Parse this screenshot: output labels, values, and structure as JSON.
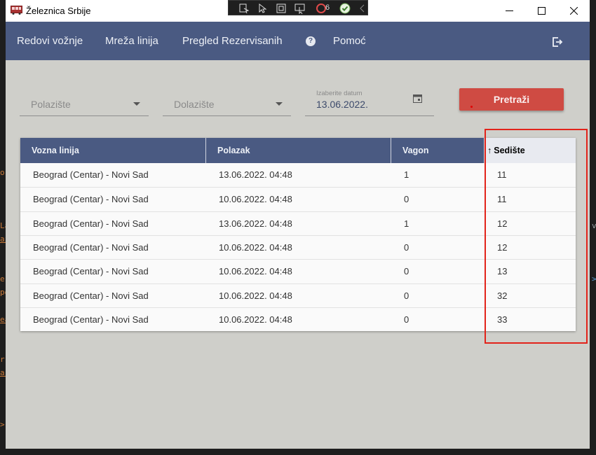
{
  "window": {
    "title": "Železnica Srbije"
  },
  "debug_toolbar": {
    "counter": "6"
  },
  "navbar": {
    "items": [
      {
        "label": "Redovi vožnje"
      },
      {
        "label": "Mreža linija"
      },
      {
        "label": "Pregled Rezervisanih"
      },
      {
        "label": "Pomoć"
      }
    ],
    "help_icon_glyph": "?"
  },
  "filters": {
    "departure_placeholder": "Polazište",
    "arrival_placeholder": "Dolazište",
    "date_label": "Izaberite datum",
    "date_value": "13.06.2022.",
    "search_label": "Pretraži"
  },
  "table": {
    "headers": [
      "Vozna linija",
      "Polazak",
      "Vagon",
      "Sedište"
    ],
    "sort_arrow": "↑",
    "rows": [
      [
        "Beograd (Centar) - Novi Sad",
        "13.06.2022. 04:48",
        "1",
        "11"
      ],
      [
        "Beograd (Centar) - Novi Sad",
        "10.06.2022. 04:48",
        "0",
        "11"
      ],
      [
        "Beograd (Centar) - Novi Sad",
        "13.06.2022. 04:48",
        "1",
        "12"
      ],
      [
        "Beograd (Centar) - Novi Sad",
        "10.06.2022. 04:48",
        "0",
        "12"
      ],
      [
        "Beograd (Centar) - Novi Sad",
        "10.06.2022. 04:48",
        "0",
        "13"
      ],
      [
        "Beograd (Centar) - Novi Sad",
        "10.06.2022. 04:48",
        "0",
        "32"
      ],
      [
        "Beograd (Centar) - Novi Sad",
        "10.06.2022. 04:48",
        "0",
        "33"
      ]
    ]
  },
  "colors": {
    "navbar": "#4a5a82",
    "background": "#cfcfca",
    "search_button": "#cf4b43",
    "annotation": "#e2231a"
  },
  "icons": [
    "train-icon",
    "minimize-icon",
    "maximize-icon",
    "close-icon",
    "help-icon",
    "logout-icon",
    "calendar-icon",
    "dropdown-caret-icon",
    "sort-up-icon"
  ]
}
